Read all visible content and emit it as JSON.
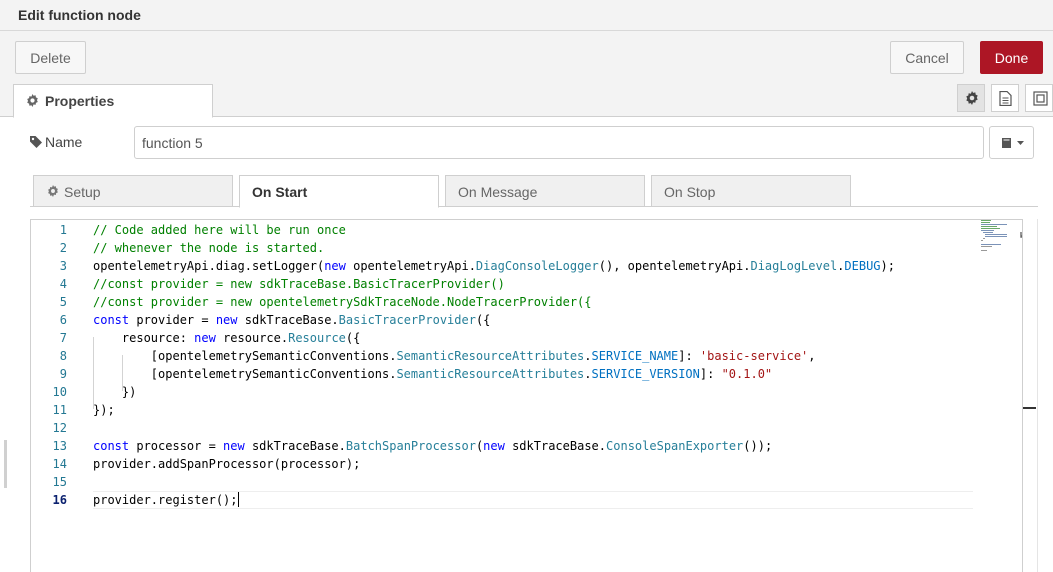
{
  "title": "Edit function node",
  "toolbar": {
    "delete_label": "Delete",
    "cancel_label": "Cancel",
    "done_label": "Done",
    "done_color": "#ad1625"
  },
  "tabs": {
    "properties_label": "Properties"
  },
  "side_icons": [
    "gear-icon",
    "description-icon",
    "appearance-icon"
  ],
  "name_field": {
    "label": "Name",
    "value": "function 5",
    "library_icon": "book-icon"
  },
  "inner_tabs": [
    {
      "label": "Setup",
      "icon": "gear-icon"
    },
    {
      "label": "On Start",
      "active": true
    },
    {
      "label": "On Message"
    },
    {
      "label": "On Stop"
    }
  ],
  "editor": {
    "current_line": 16,
    "lines": [
      [
        {
          "t": "// Code added here will be run once",
          "c": "com"
        }
      ],
      [
        {
          "t": "// whenever the node is started.",
          "c": "com"
        }
      ],
      [
        {
          "t": "opentelemetryApi.diag.setLogger("
        },
        {
          "t": "new",
          "c": "kw"
        },
        {
          "t": " opentelemetryApi."
        },
        {
          "t": "DiagConsoleLogger",
          "c": "ty"
        },
        {
          "t": "(), opentelemetryApi."
        },
        {
          "t": "DiagLogLevel",
          "c": "ty"
        },
        {
          "t": "."
        },
        {
          "t": "DEBUG",
          "c": "pr"
        },
        {
          "t": ");"
        }
      ],
      [
        {
          "t": "//const provider = new sdkTraceBase.BasicTracerProvider()",
          "c": "com"
        }
      ],
      [
        {
          "t": "//const provider = new opentelemetrySdkTraceNode.NodeTracerProvider({",
          "c": "com"
        }
      ],
      [
        {
          "t": "const",
          "c": "kw"
        },
        {
          "t": " provider = "
        },
        {
          "t": "new",
          "c": "kw"
        },
        {
          "t": " sdkTraceBase."
        },
        {
          "t": "BasicTracerProvider",
          "c": "ty"
        },
        {
          "t": "({"
        }
      ],
      [
        {
          "t": "    resource: "
        },
        {
          "t": "new",
          "c": "kw"
        },
        {
          "t": " resource."
        },
        {
          "t": "Resource",
          "c": "ty"
        },
        {
          "t": "({"
        }
      ],
      [
        {
          "t": "        [opentelemetrySemanticConventions."
        },
        {
          "t": "SemanticResourceAttributes",
          "c": "ty"
        },
        {
          "t": "."
        },
        {
          "t": "SERVICE_NAME",
          "c": "pr"
        },
        {
          "t": "]: "
        },
        {
          "t": "'basic-service'",
          "c": "str"
        },
        {
          "t": ","
        }
      ],
      [
        {
          "t": "        [opentelemetrySemanticConventions."
        },
        {
          "t": "SemanticResourceAttributes",
          "c": "ty"
        },
        {
          "t": "."
        },
        {
          "t": "SERVICE_VERSION",
          "c": "pr"
        },
        {
          "t": "]: "
        },
        {
          "t": "\"0.1.0\"",
          "c": "str"
        }
      ],
      [
        {
          "t": "    })"
        }
      ],
      [
        {
          "t": "});"
        }
      ],
      [],
      [
        {
          "t": "const",
          "c": "kw"
        },
        {
          "t": " processor = "
        },
        {
          "t": "new",
          "c": "kw"
        },
        {
          "t": " sdkTraceBase."
        },
        {
          "t": "BatchSpanProcessor",
          "c": "ty"
        },
        {
          "t": "("
        },
        {
          "t": "new",
          "c": "kw"
        },
        {
          "t": " sdkTraceBase."
        },
        {
          "t": "ConsoleSpanExporter",
          "c": "ty"
        },
        {
          "t": "());"
        }
      ],
      [
        {
          "t": "provider.addSpanProcessor(processor);"
        }
      ],
      [],
      [
        {
          "t": "provider.register();"
        }
      ]
    ]
  }
}
